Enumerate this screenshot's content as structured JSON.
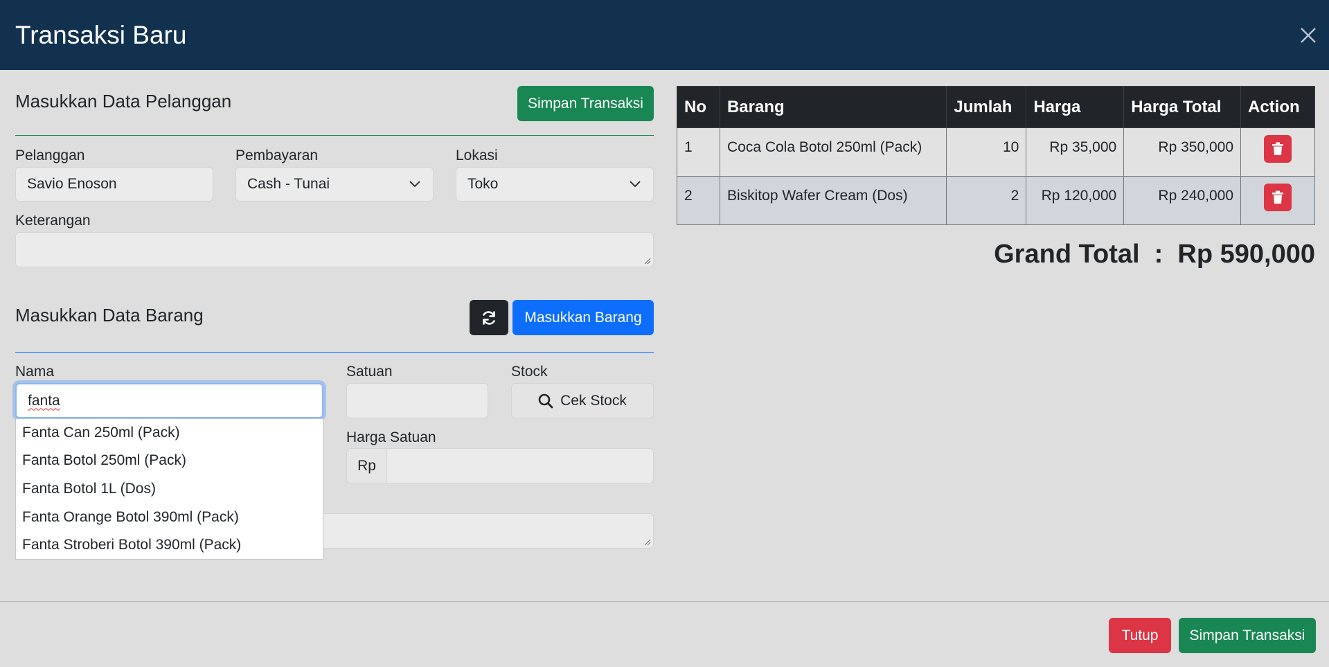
{
  "modal": {
    "title": "Transaksi Baru"
  },
  "customer_section": {
    "title": "Masukkan Data Pelanggan",
    "save_button": "Simpan Transaksi",
    "pelanggan_label": "Pelanggan",
    "pelanggan_value": "Savio Enoson",
    "pembayaran_label": "Pembayaran",
    "pembayaran_value": "Cash - Tunai",
    "lokasi_label": "Lokasi",
    "lokasi_value": "Toko",
    "keterangan_label": "Keterangan",
    "keterangan_value": ""
  },
  "item_section": {
    "title": "Masukkan Data Barang",
    "refresh_icon": "refresh-icon",
    "add_button": "Masukkan Barang",
    "nama_label": "Nama",
    "nama_value": "fanta",
    "satuan_label": "Satuan",
    "satuan_value": "",
    "stock_label": "Stock",
    "cek_stock_button": "Cek Stock",
    "harga_satuan_label": "Harga Satuan",
    "currency_prefix": "Rp",
    "harga_satuan_value": "",
    "suggestions": [
      "Fanta Can 250ml (Pack)",
      "Fanta Botol 250ml (Pack)",
      "Fanta Botol 1L (Dos)",
      "Fanta Orange Botol 390ml (Pack)",
      "Fanta Stroberi Botol 390ml (Pack)"
    ]
  },
  "cart": {
    "headers": [
      "No",
      "Barang",
      "Jumlah",
      "Harga",
      "Harga Total",
      "Action"
    ],
    "rows": [
      {
        "no": "1",
        "barang": "Coca Cola Botol 250ml (Pack)",
        "jumlah": "10",
        "harga": "Rp 35,000",
        "total": "Rp 350,000"
      },
      {
        "no": "2",
        "barang": "Biskitop Wafer Cream (Dos)",
        "jumlah": "2",
        "harga": "Rp 120,000",
        "total": "Rp 240,000"
      }
    ],
    "grand_total": "Grand Total  :  Rp 590,000"
  },
  "footer": {
    "close_button": "Tutup",
    "save_button": "Simpan Transaksi"
  },
  "colors": {
    "header_bg": "#12314f",
    "success": "#198754",
    "primary": "#0d6efd",
    "danger": "#dc3545",
    "dark": "#212529"
  }
}
